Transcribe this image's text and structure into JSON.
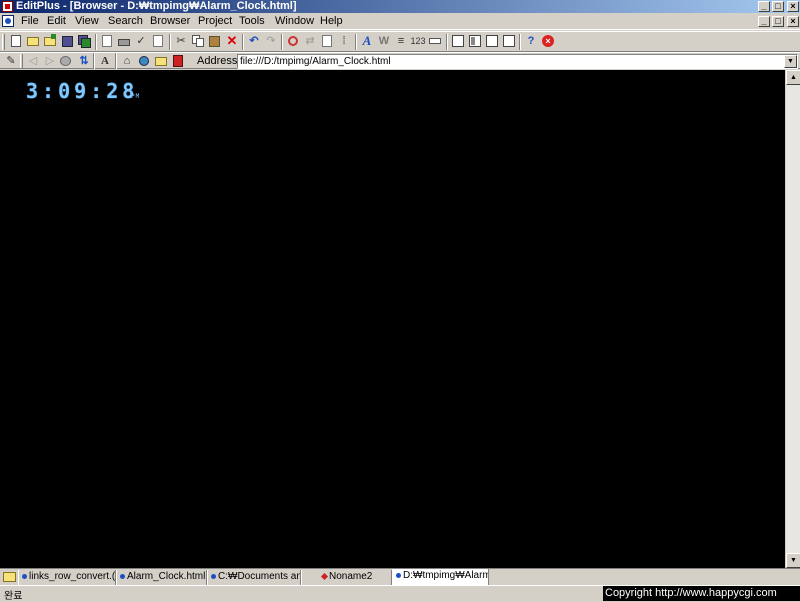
{
  "window": {
    "title": "EditPlus - [Browser - D:₩tmpimg₩Alarm_Clock.html]",
    "caption_buttons": [
      "_",
      "□",
      "×"
    ]
  },
  "menu": {
    "items": [
      "File",
      "Edit",
      "View",
      "Search",
      "Browser",
      "Project",
      "Tools",
      "Window",
      "Help"
    ]
  },
  "toolbar": {
    "icons": [
      "new-file-icon",
      "open-icon",
      "open-remote-icon",
      "save-icon",
      "save-all-icon",
      "print-preview-icon",
      "print-icon",
      "spell-check-icon",
      "page-icon",
      "cut-icon",
      "copy-icon",
      "paste-icon",
      "delete-icon",
      "undo-icon",
      "redo-icon",
      "find-icon",
      "replace-icon",
      "goto-icon",
      "column-icon",
      "font-icon",
      "word-wrap-icon",
      "indent-icon",
      "line-number-icon",
      "ruler-icon",
      "browser-icon",
      "directory-icon",
      "clip-icon",
      "output-icon",
      "help-icon",
      "close-doc-icon"
    ]
  },
  "browser_bar": {
    "address_label": "Address",
    "address_value": "file:///D:/tmpimg/Alarm_Clock.html"
  },
  "clock": {
    "time": "3:09:28",
    "ampm": "PM",
    "color": "#7ec8ff"
  },
  "tabs": [
    {
      "label": "links_row_convert.(",
      "active": false
    },
    {
      "label": "Alarm_Clock.html",
      "active": false
    },
    {
      "label": "C:₩Documents an",
      "active": false
    },
    {
      "label": "Noname2",
      "active": false
    },
    {
      "label": "D:₩tmpimg₩Alarm",
      "active": true
    }
  ],
  "status": {
    "text": "완료",
    "copyright": "Copyright   http://www.happycgi.com"
  }
}
